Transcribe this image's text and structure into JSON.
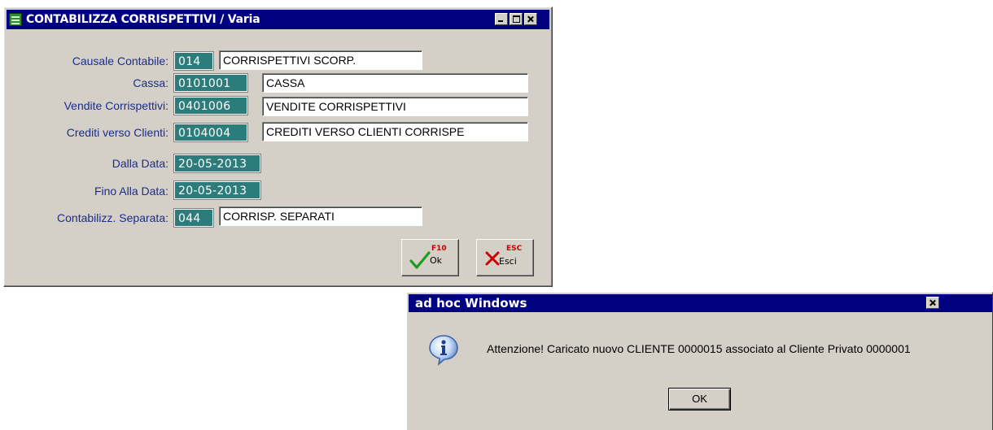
{
  "main_window": {
    "title": "CONTABILIZZA CORRISPETTIVI / Varia",
    "fields": {
      "causale_contabile": {
        "label": "Causale Contabile:",
        "code": "014",
        "description": "CORRISPETTIVI SCORP."
      },
      "cassa": {
        "label": "Cassa:",
        "code": "0101001",
        "description": "CASSA"
      },
      "vendite_corrispettivi": {
        "label": "Vendite Corrispettivi:",
        "code": "0401006",
        "description": "VENDITE CORRISPETTIVI"
      },
      "crediti_verso_clienti": {
        "label": "Crediti verso Clienti:",
        "code": "0104004",
        "description": "CREDITI VERSO CLIENTI CORRISPE"
      },
      "dalla_data": {
        "label": "Dalla Data:",
        "value": "20-05-2013"
      },
      "fino_alla_data": {
        "label": "Fino Alla Data:",
        "value": "20-05-2013"
      },
      "contabilizz_separata": {
        "label": "Contabilizz. Separata:",
        "code": "044",
        "description": "CORRISP. SEPARATI"
      }
    },
    "buttons": {
      "ok": {
        "key": "F10",
        "label": "Ok",
        "icon": "checkmark-icon",
        "color": "#1a9e1a"
      },
      "esci": {
        "key": "ESC",
        "label": "Esci",
        "icon": "cross-icon",
        "color": "#cc0000"
      }
    }
  },
  "message_box": {
    "title": "ad hoc Windows",
    "icon": "info-icon",
    "message": "Attenzione! Caricato nuovo CLIENTE 0000015 associato al Cliente Privato 0000001",
    "ok_label": "OK"
  },
  "colors": {
    "title_bar": "#000080",
    "code_field_bg": "#2c7c7c",
    "label_text": "#1a2d8c",
    "window_bg": "#d4d0c8"
  }
}
